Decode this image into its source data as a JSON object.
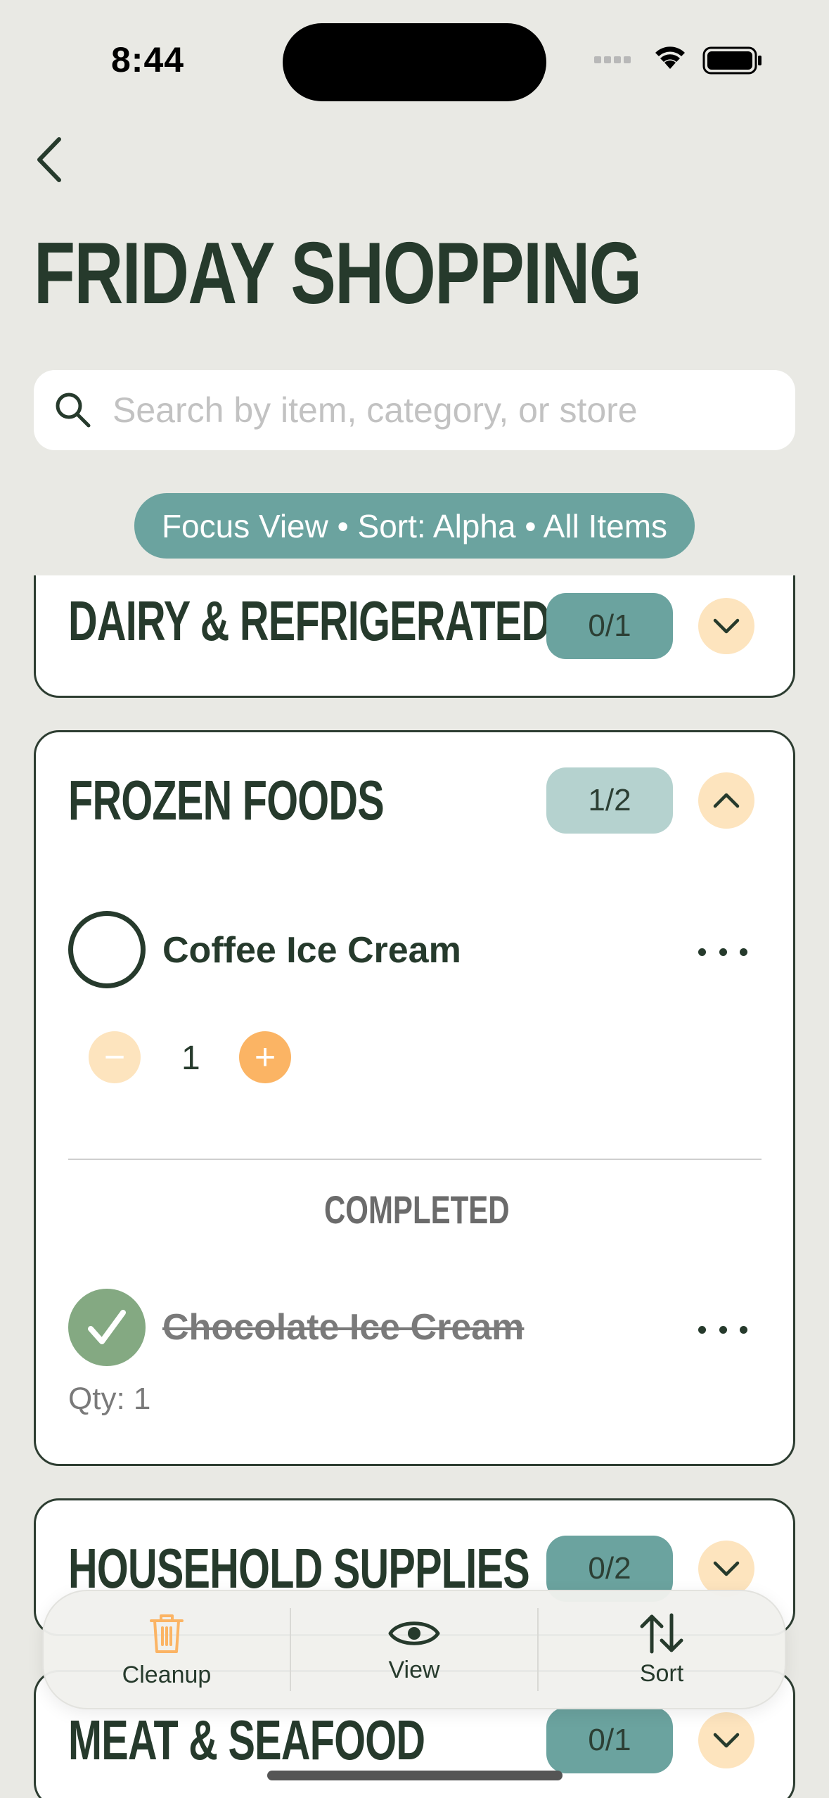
{
  "status_bar": {
    "time": "8:44"
  },
  "header": {
    "title": "FRIDAY SHOPPING"
  },
  "search": {
    "placeholder": "Search by item, category, or store"
  },
  "filter": {
    "label": "Focus View • Sort: Alpha • All Items"
  },
  "categories": [
    {
      "name": "DAIRY & REFRIGERATED",
      "count": "0/1",
      "expanded": false
    },
    {
      "name": "FROZEN FOODS",
      "count": "1/2",
      "expanded": true,
      "items": [
        {
          "name": "Coffee Ice Cream",
          "quantity": "1",
          "completed": false
        }
      ],
      "completed_label": "COMPLETED",
      "completed_items": [
        {
          "name": "Chocolate Ice Cream",
          "qty_note": "Qty: 1",
          "completed": true
        }
      ]
    },
    {
      "name": "HOUSEHOLD SUPPLIES",
      "count": "0/2",
      "expanded": false
    },
    {
      "name": "MEAT & SEAFOOD",
      "count": "0/1",
      "expanded": false
    }
  ],
  "toolbar": {
    "cleanup_label": "Cleanup",
    "view_label": "View",
    "sort_label": "Sort"
  },
  "colors": {
    "accent_teal": "#6ba39f",
    "accent_orange": "#fbb464",
    "check_green": "#84a982",
    "dark_green": "#263a2c"
  },
  "icons": {
    "back": "chevron-left-icon",
    "search": "search-icon",
    "collapse": "chevron-down-icon",
    "expand": "chevron-up-icon",
    "cleanup": "trash-icon",
    "view": "eye-icon",
    "sort": "sort-arrows-icon"
  }
}
